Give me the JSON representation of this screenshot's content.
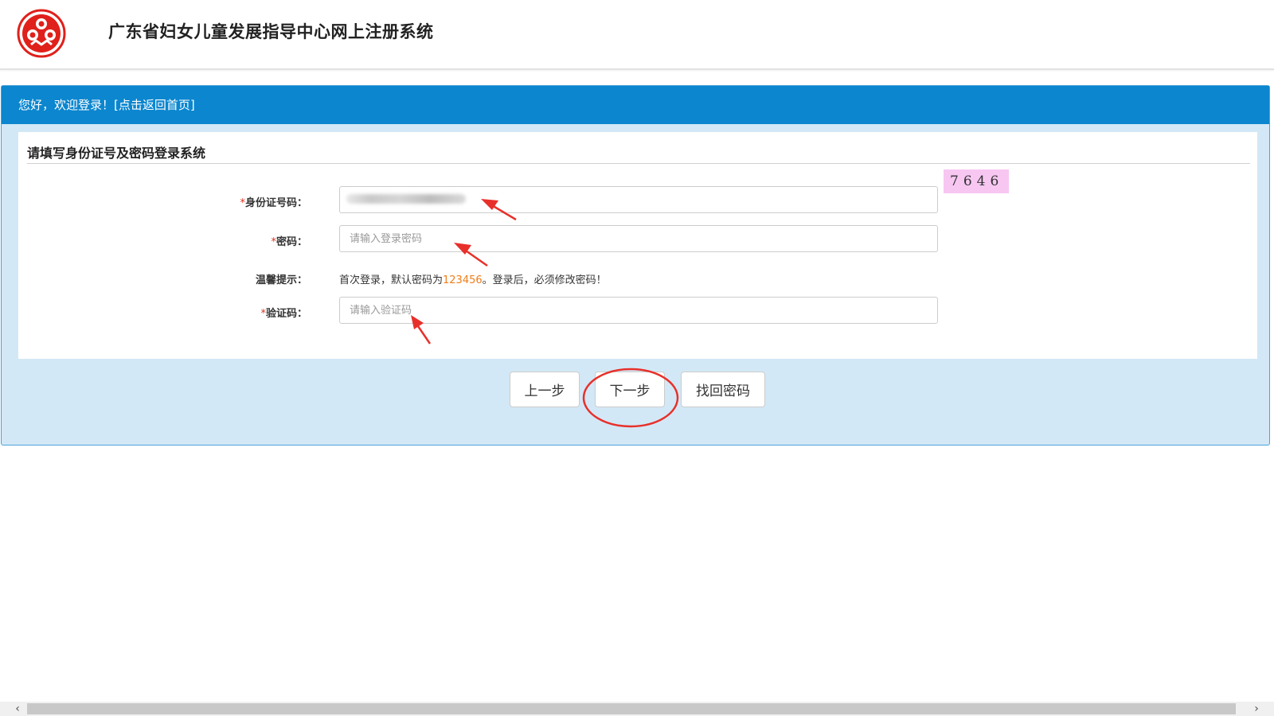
{
  "header": {
    "site_title": "广东省妇女儿童发展指导中心网上注册系统",
    "logo_icon": "womens-federation-logo-icon"
  },
  "panel": {
    "greeting": "您好，欢迎登录！",
    "home_link": "[点击返回首页]",
    "form_title": "请填写身份证号及密码登录系统"
  },
  "form": {
    "id_label": "身份证号码：",
    "password_label": "密码：",
    "password_placeholder": "请输入登录密码",
    "hint_label": "温馨提示：",
    "hint_prefix": "首次登录，默认密码为",
    "hint_password": "123456",
    "hint_suffix": "。登录后，必须修改密码！",
    "captcha_label": "验证码：",
    "captcha_placeholder": "请输入验证码",
    "captcha_code": "7646",
    "required_mark": "*"
  },
  "buttons": {
    "prev": "上一步",
    "next": "下一步",
    "find_password": "找回密码"
  },
  "scrollbar": {
    "left_arrow": "‹",
    "right_arrow": "›"
  },
  "colors": {
    "brand_blue": "#0b86cf",
    "panel_bg": "#d3e8f6",
    "hint_orange": "#ef7d18",
    "required_red": "#e0301e",
    "captcha_bg": "#f7c7f2",
    "annotation_red": "#e8302a"
  }
}
